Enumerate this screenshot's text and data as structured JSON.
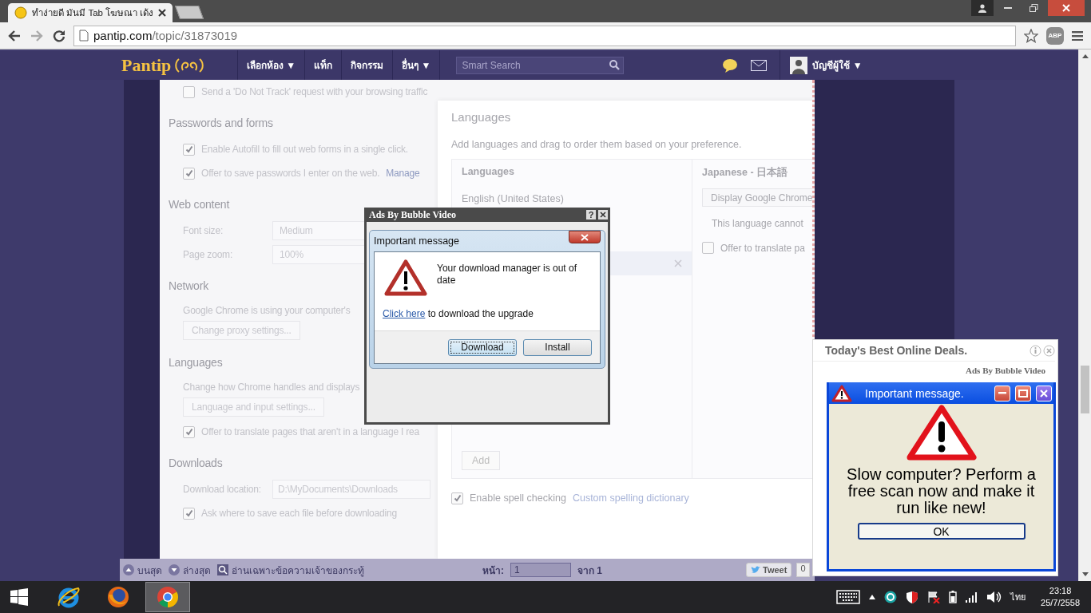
{
  "browser": {
    "tab": {
      "title": "ทำง่ายดี มันมี Tab โฆษณา เด้ง",
      "selected": true
    },
    "url": {
      "host": "pantip.com",
      "path": "/topic/31873019"
    },
    "adblock_badge": "ABP"
  },
  "site_nav": {
    "logo": "Pantip",
    "menu": [
      "เลือกห้อง ▼",
      "แท็ก",
      "กิจกรรม",
      "อื่นๆ ▼"
    ],
    "search": {
      "placeholder": "Smart Search"
    },
    "account": "บัญชีผู้ใช้ ▼"
  },
  "settings": {
    "items": [
      {
        "kind": "checkbox",
        "label": "Send a 'Do Not Track' request with your browsing traffic",
        "checked": false
      },
      {
        "kind": "heading",
        "label": "Passwords and forms"
      },
      {
        "kind": "checkbox",
        "label": "Enable Autofill to fill out web forms in a single click.",
        "checked": true
      },
      {
        "kind": "checkbox",
        "label": "Offer to save passwords I enter on the web.",
        "link": "Manage",
        "checked": true
      },
      {
        "kind": "heading",
        "label": "Web content"
      },
      {
        "kind": "field",
        "label": "Font size:",
        "value": "Medium"
      },
      {
        "kind": "field",
        "label": "Page zoom:",
        "value": "100%"
      },
      {
        "kind": "heading",
        "label": "Network"
      },
      {
        "kind": "text",
        "label": "Google Chrome is using your computer's"
      },
      {
        "kind": "button",
        "label": "Change proxy settings..."
      },
      {
        "kind": "heading",
        "label": "Languages"
      },
      {
        "kind": "text",
        "label": "Change how Chrome handles and displays"
      },
      {
        "kind": "button",
        "label": "Language and input settings..."
      },
      {
        "kind": "checkbox",
        "label": "Offer to translate pages that aren't in a language I rea",
        "checked": true
      },
      {
        "kind": "heading",
        "label": "Downloads"
      },
      {
        "kind": "field",
        "label": "Download location:",
        "value": "D:\\MyDocuments\\Downloads"
      },
      {
        "kind": "checkbox",
        "label": "Ask where to save each file before downloading",
        "checked": true
      }
    ]
  },
  "languages_dialog": {
    "title": "Languages",
    "description": "Add languages and drag to order them based on your preference.",
    "list_heading": "Languages",
    "languages": [
      {
        "label": "English (United States)",
        "selected": false
      },
      {
        "selected": true
      }
    ],
    "add_button": "Add",
    "detail_heading": "Japanese - 日本語",
    "display_button": "Display Google Chrome",
    "note": "This language cannot",
    "translate": {
      "label": "Offer to translate pa",
      "checked": false
    },
    "spell_check": {
      "label": "Enable spell checking",
      "checked": true
    },
    "spelling_link": "Custom spelling dictionary"
  },
  "ad_dialog": {
    "title": "Ads By Bubble Video",
    "help": "?",
    "inner_title": "Important message",
    "message": "Your download manager is out of date",
    "link": "Click here",
    "link_text": " to download the upgrade",
    "buttons": [
      {
        "label": "Download",
        "selected": true
      },
      {
        "label": "Install",
        "selected": false
      }
    ]
  },
  "ad_popup": {
    "heading": "Today's Best Online Deals.",
    "source": "Ads By Bubble Video",
    "window_title": "Important message.",
    "message": "Slow computer? Perform a free scan now and make it run like new!",
    "button": "OK"
  },
  "page_footer": {
    "top": "บนสุด",
    "bottom": "ล่างสุด",
    "owner_only": "อ่านเฉพาะข้อความเจ้าของกระทู้",
    "page_label": "หน้า:",
    "page": "1",
    "page_total": "จาก 1",
    "tweet": "Tweet",
    "tweet_count": "0"
  },
  "taskbar": {
    "apps": [
      {
        "kind": "ie",
        "selected": false
      },
      {
        "kind": "firefox",
        "selected": false
      },
      {
        "kind": "chrome",
        "selected": true
      }
    ],
    "language": "ไทย",
    "time": "23:18",
    "date": "25/7/2558"
  }
}
